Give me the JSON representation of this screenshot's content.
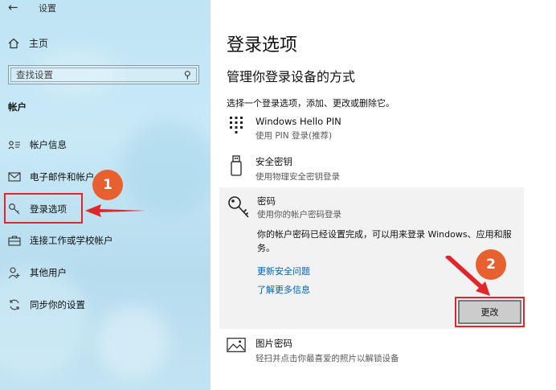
{
  "window": {
    "title": "设置",
    "back_icon": "back-arrow-icon"
  },
  "sidebar": {
    "home_label": "主页",
    "search_placeholder": "查找设置",
    "section": "帐户",
    "items": [
      {
        "label": "帐户信息",
        "icon": "person-card-icon"
      },
      {
        "label": "电子邮件和帐户",
        "icon": "mail-icon"
      },
      {
        "label": "登录选项",
        "icon": "key-icon",
        "selected": true
      },
      {
        "label": "连接工作或学校帐户",
        "icon": "briefcase-icon"
      },
      {
        "label": "其他用户",
        "icon": "person-add-icon"
      },
      {
        "label": "同步你的设置",
        "icon": "sync-icon"
      }
    ]
  },
  "main": {
    "title": "登录选项",
    "subtitle": "管理你登录设备的方式",
    "intro": "选择一个登录选项，添加、更改或删除它。",
    "options": {
      "hello_pin": {
        "title": "Windows Hello PIN",
        "desc": "使用 PIN 登录(推荐)"
      },
      "security_key": {
        "title": "安全密钥",
        "desc": "使用物理安全密钥登录"
      },
      "password": {
        "title": "密码",
        "desc": "使用你的帐户密码登录",
        "status": "你的帐户密码已经设置完成，可以用来登录 Windows、应用和服务。",
        "link_security_questions": "更新安全问题",
        "link_learn_more": "了解更多信息",
        "change_button": "更改"
      },
      "picture_password": {
        "title": "图片密码",
        "desc": "轻扫并点击你最喜爱的照片以解锁设备"
      }
    }
  },
  "annotations": {
    "callout_1": "1",
    "callout_2": "2",
    "highlight_color": "#e0262b",
    "callout_color": "#e8602f"
  },
  "colors": {
    "link": "#0063b1",
    "panel": "#f2f2f2",
    "sidebar": "#c3e6f4"
  }
}
